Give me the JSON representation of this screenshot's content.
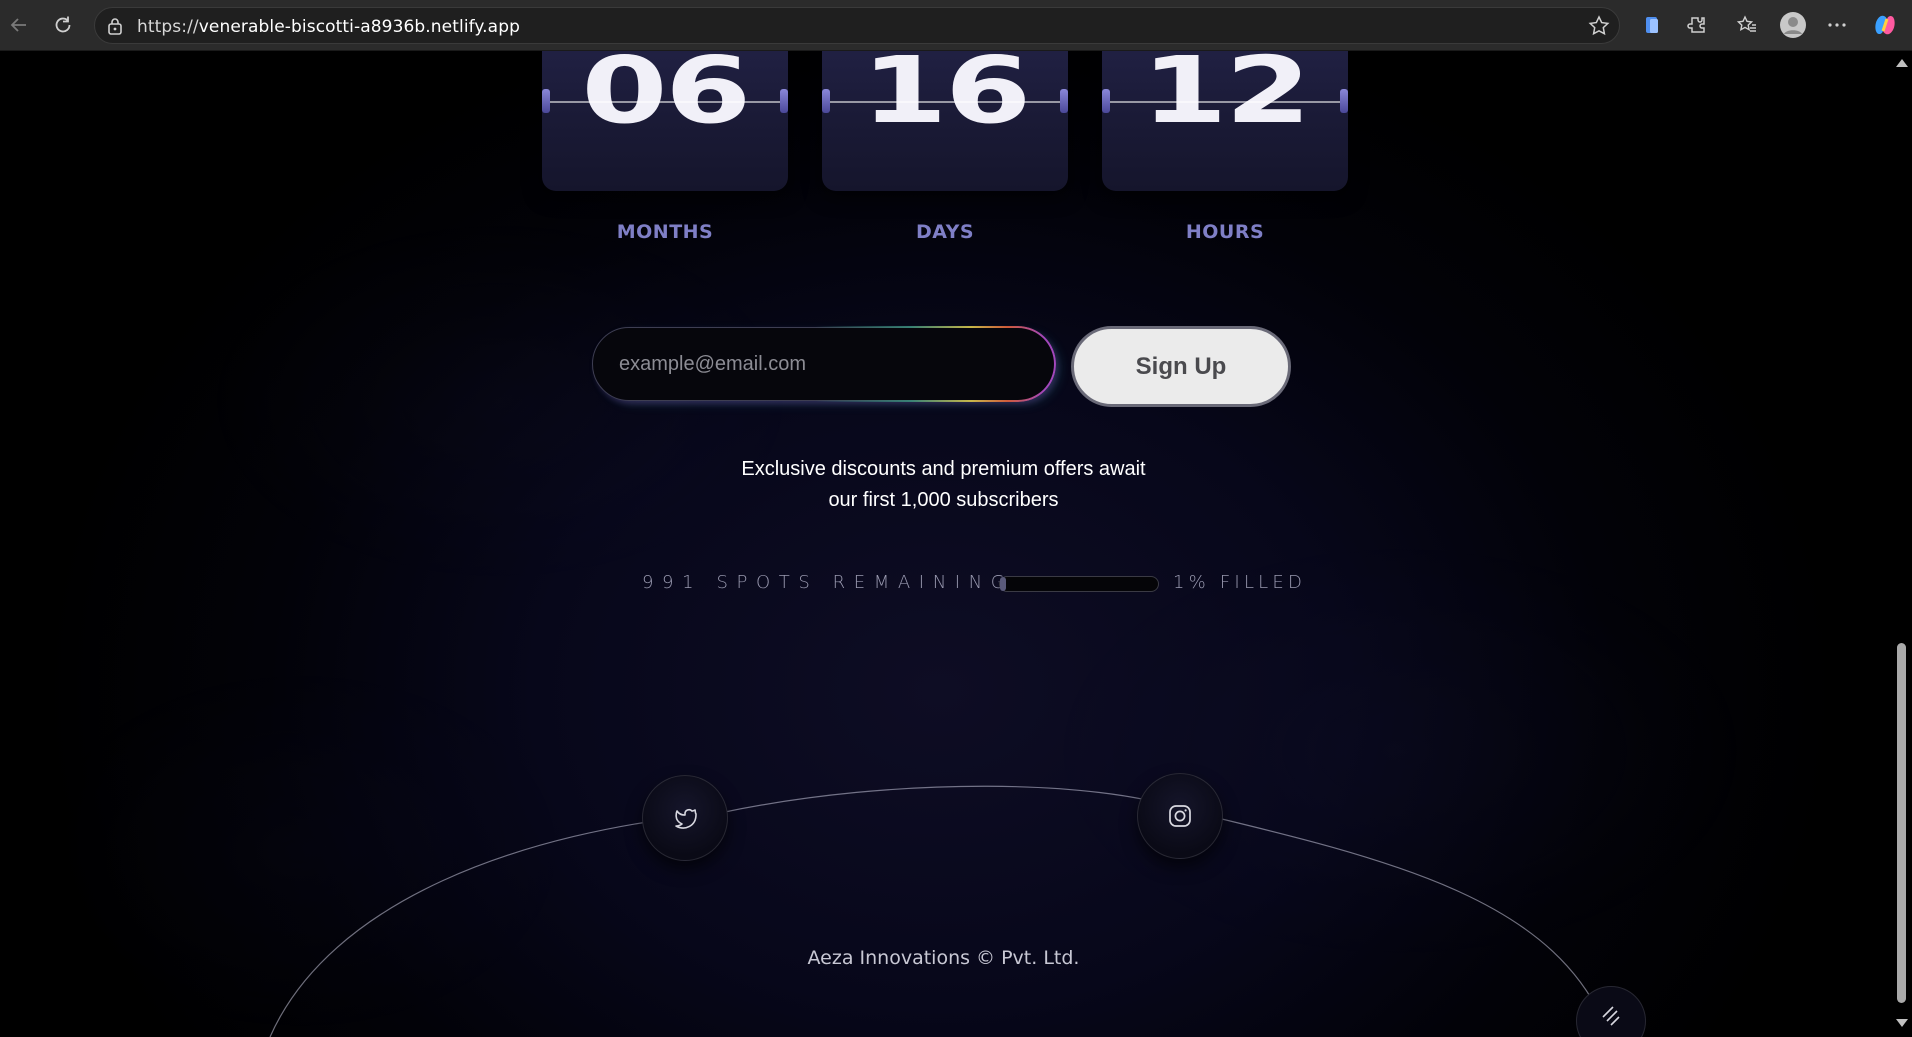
{
  "browser": {
    "url_prefix": "https://",
    "url_host": "venerable-biscotti-a8936b.netlify.app",
    "icons": [
      "back-icon",
      "reload-icon",
      "lock-icon",
      "star-icon",
      "collections-icon",
      "extensions-icon",
      "favorites-icon",
      "profile-icon",
      "more-icon",
      "copilot-icon"
    ]
  },
  "countdown": {
    "units": [
      {
        "value": "06",
        "label": "MONTHS"
      },
      {
        "value": "16",
        "label": "DAYS"
      },
      {
        "value": "12",
        "label": "HOURS"
      }
    ]
  },
  "signup": {
    "email_placeholder": "example@email.com",
    "email_value": "",
    "button_label": "Sign Up"
  },
  "offer": {
    "line1": "Exclusive discounts and premium offers await",
    "line2": "our first 1,000 subscribers"
  },
  "spots": {
    "remaining_text": "991 SPOTS REMAINING",
    "filled_text": "1% FILLED",
    "filled_fraction": 0.01
  },
  "footer": {
    "social": [
      "twitter-icon",
      "instagram-icon"
    ],
    "copyright": "Aeza Innovations © Pvt. Ltd."
  },
  "colors": {
    "accent_label": "#7f7fc6",
    "background": "#07071a",
    "button_bg": "#ebebeb"
  }
}
